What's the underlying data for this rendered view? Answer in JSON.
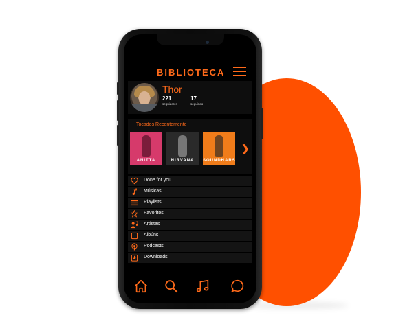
{
  "colors": {
    "accent": "#ff6a1a",
    "blob": "#ff5000",
    "screen_bg": "#000000",
    "panel_bg": "#141414"
  },
  "header": {
    "title": "BIBLIOTECA",
    "menu_icon": "hamburger-icon"
  },
  "profile": {
    "name": "Thor",
    "followers_count": "221",
    "followers_label": "seguidores",
    "following_count": "17",
    "following_label": "seguindo"
  },
  "recent": {
    "title": "Tocados Recentemente",
    "items": [
      {
        "label": "ANITTA",
        "color": "#d63a6b"
      },
      {
        "label": "NIRVANA",
        "color": "#2a2a2a"
      },
      {
        "label": "SOUNDHARS",
        "color": "#f07c1a"
      }
    ],
    "next_icon": "chevron-right-icon"
  },
  "menu": {
    "items": [
      {
        "label": "Done for you",
        "icon": "heart-icon"
      },
      {
        "label": "Músicas",
        "icon": "music-note-icon"
      },
      {
        "label": "Playlists",
        "icon": "playlist-icon"
      },
      {
        "label": "Favoritos",
        "icon": "star-icon"
      },
      {
        "label": "Artistas",
        "icon": "artist-icon"
      },
      {
        "label": "Albúns",
        "icon": "album-icon"
      },
      {
        "label": "Podcasts",
        "icon": "podcast-icon"
      },
      {
        "label": "Downloads",
        "icon": "download-icon"
      }
    ]
  },
  "bottom_nav": {
    "items": [
      {
        "icon": "home-icon"
      },
      {
        "icon": "search-icon"
      },
      {
        "icon": "music-icon"
      },
      {
        "icon": "chat-icon"
      }
    ]
  }
}
